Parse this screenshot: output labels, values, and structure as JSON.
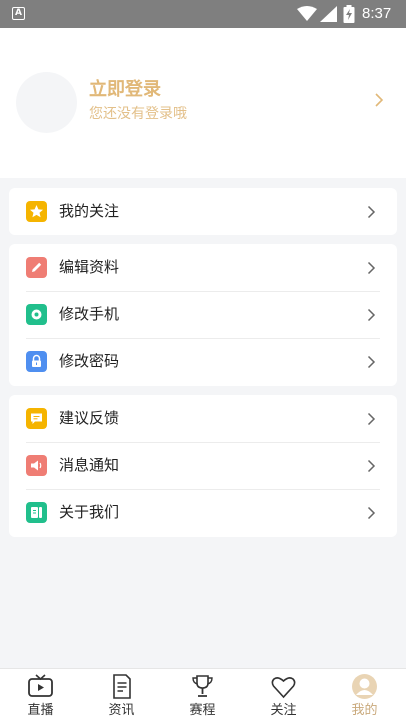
{
  "status_bar": {
    "app_indicator": "A",
    "time": "8:37",
    "icons": [
      "wifi-icon",
      "signal-icon",
      "battery-charging-icon"
    ]
  },
  "profile": {
    "login_title": "立即登录",
    "login_subtitle": "您还没有登录哦"
  },
  "menu": {
    "group1": [
      {
        "label": "我的关注",
        "icon": "star-icon",
        "color": "#f5b400"
      }
    ],
    "group2": [
      {
        "label": "编辑资料",
        "icon": "pencil-icon",
        "color": "#ef7d74"
      },
      {
        "label": "修改手机",
        "icon": "phone-settings-icon",
        "color": "#21bf8c"
      },
      {
        "label": "修改密码",
        "icon": "lock-icon",
        "color": "#4f8ff0"
      }
    ],
    "group3": [
      {
        "label": "建议反馈",
        "icon": "feedback-icon",
        "color": "#f5b400"
      },
      {
        "label": "消息通知",
        "icon": "speaker-icon",
        "color": "#ef7d74"
      },
      {
        "label": "关于我们",
        "icon": "info-book-icon",
        "color": "#21bf8c"
      }
    ]
  },
  "tabbar": {
    "tabs": [
      {
        "label": "直播",
        "icon": "tv-icon"
      },
      {
        "label": "资讯",
        "icon": "document-icon"
      },
      {
        "label": "赛程",
        "icon": "trophy-icon"
      },
      {
        "label": "关注",
        "icon": "heart-icon"
      },
      {
        "label": "我的",
        "icon": "user-icon"
      }
    ],
    "active_index": 4,
    "active_color": "#c9a97c"
  }
}
